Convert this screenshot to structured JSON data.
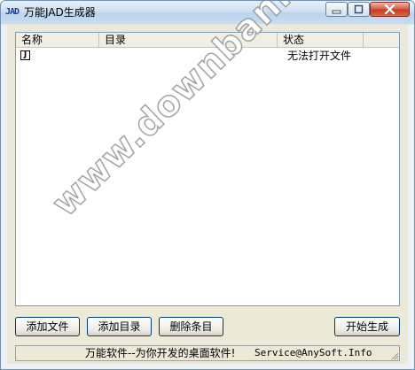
{
  "window": {
    "icon_text": "JAD",
    "title": "万能JAD生成器"
  },
  "list": {
    "columns": [
      "名称",
      "目录",
      "状态"
    ],
    "rows": [
      {
        "icon": "J",
        "name": "",
        "directory": "",
        "status": "无法打开文件"
      }
    ]
  },
  "watermark": "www.downbank.cn",
  "buttons": {
    "add_file": "添加文件",
    "add_dir": "添加目录",
    "delete_item": "删除条目",
    "start": "开始生成"
  },
  "statusbar": {
    "text": "万能软件--为你开发的桌面软件!",
    "email": "Service@AnySoft.Info"
  },
  "colors": {
    "title_gradient_top": "#e8f1fb",
    "title_gradient_bottom": "#bcd3ec",
    "close_button": "#c03d22",
    "dialog_bg": "#ece9d8",
    "list_border": "#7f9db9"
  }
}
